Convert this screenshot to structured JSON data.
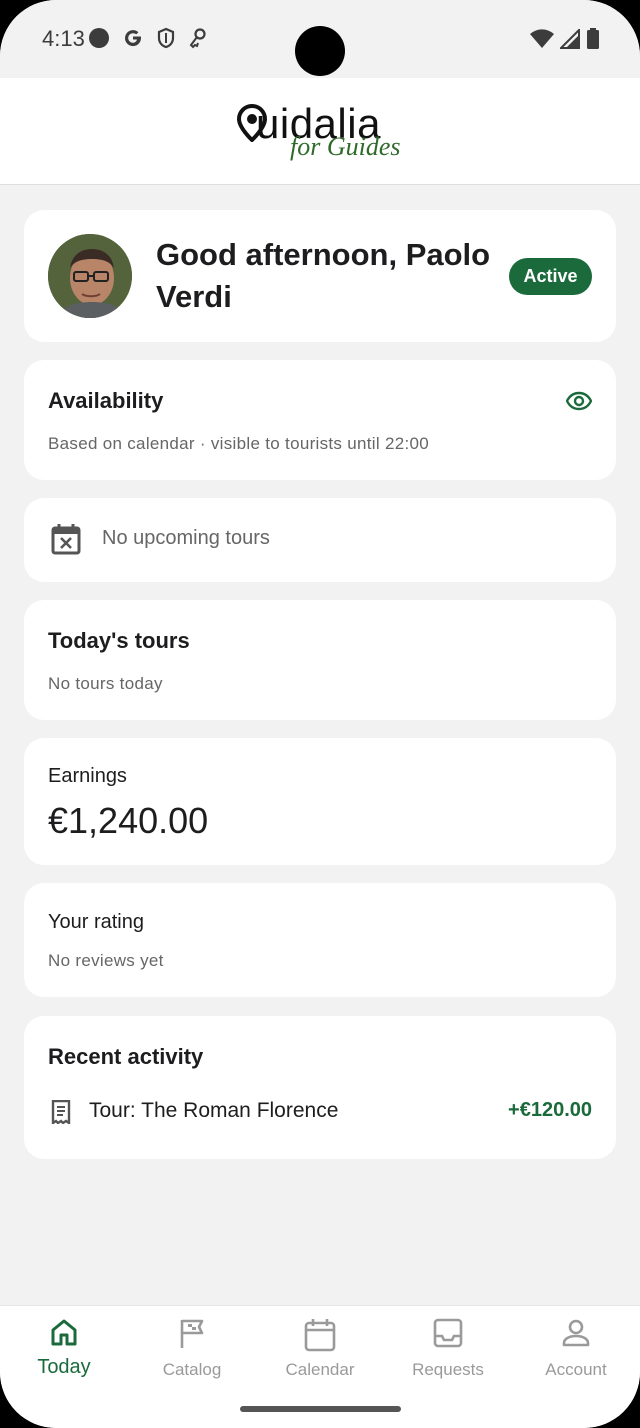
{
  "status_bar": {
    "time": "4:13"
  },
  "app": {
    "logo_main": "uidalia",
    "logo_sub": "for Guides"
  },
  "greeting": {
    "text": "Good afternoon, Paolo Verdi",
    "status": "Active"
  },
  "availability": {
    "title": "Availability",
    "subtitle": "Based on calendar · visible to tourists until 22:00"
  },
  "upcoming": {
    "text": "No upcoming tours"
  },
  "today_tours": {
    "title": "Today's tours",
    "subtitle": "No tours today"
  },
  "earnings": {
    "label": "Earnings",
    "amount": "€1,240.00"
  },
  "rating": {
    "label": "Your rating",
    "subtitle": "No reviews yet"
  },
  "activity": {
    "title": "Recent activity",
    "items": [
      {
        "label": "Tour: The Roman Florence",
        "amount": "+€120.00"
      }
    ]
  },
  "nav": {
    "items": [
      {
        "label": "Today",
        "icon": "home-icon",
        "active": true
      },
      {
        "label": "Catalog",
        "icon": "flag-icon",
        "active": false
      },
      {
        "label": "Calendar",
        "icon": "calendar-icon",
        "active": false
      },
      {
        "label": "Requests",
        "icon": "inbox-icon",
        "active": false
      },
      {
        "label": "Account",
        "icon": "person-icon",
        "active": false
      }
    ]
  },
  "colors": {
    "accent": "#1a6a3c",
    "background": "#f2f2f2",
    "card": "#ffffff"
  }
}
